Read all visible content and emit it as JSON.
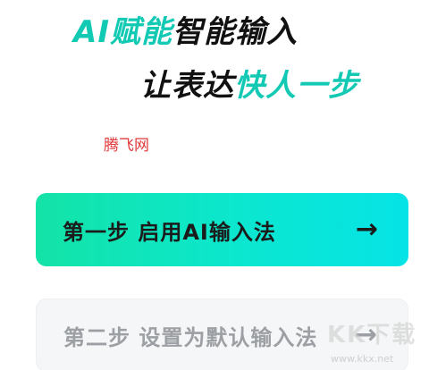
{
  "headline": {
    "line1_accent": "AI赋能",
    "line1_rest": "智能输入",
    "line2_rest": "让表达",
    "line2_accent": "快人一步"
  },
  "watermark_text": "腾飞网",
  "steps": [
    {
      "label": "第一步  启用AI输入法",
      "arrow": "→"
    },
    {
      "label": "第二步  设置为默认输入法",
      "arrow": "→"
    }
  ],
  "site_logo": {
    "text": "KK下载",
    "url": "www.kkx.net"
  },
  "colors": {
    "accent": "#12c9b4",
    "step_gradient_start": "#14e3a7",
    "step_gradient_end": "#06e3e6",
    "watermark": "#e0383a"
  }
}
